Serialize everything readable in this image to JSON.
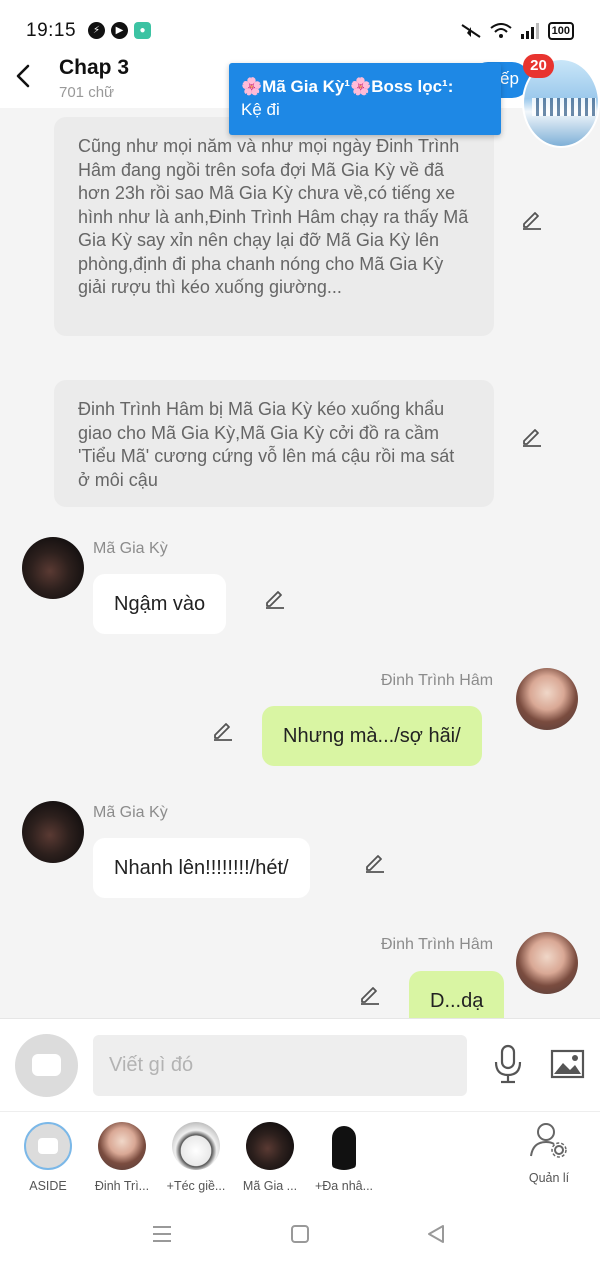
{
  "status_bar": {
    "time": "19:15",
    "battery": "100",
    "app_icons": [
      "messenger-icon",
      "media-icon",
      "chat-app-icon"
    ],
    "right_icons": [
      "mute-icon",
      "wifi-icon",
      "signal-icon"
    ]
  },
  "header": {
    "title": "Chap 3",
    "subtitle": "701 chữ"
  },
  "notification": {
    "sender": "🌸Mã Gia Kỳ¹🌸Boss lọc¹:",
    "message": "Kệ đi",
    "pill_text": "ếp",
    "badge_count": "20",
    "accent_color": "#1e88e5"
  },
  "messages": [
    {
      "type": "narration",
      "text": "Cũng như mọi năm và như mọi ngày Đinh Trình Hâm đang ngồi trên sofa đợi Mã Gia Kỳ về đã hơn 23h rồi sao Mã Gia Kỳ chưa về,có tiếng xe hình như là anh,Đinh Trình Hâm chạy ra thấy Mã Gia Kỳ say xỉn nên chạy lại đỡ Mã Gia Kỳ lên phòng,định đi pha chanh nóng cho Mã Gia Kỳ giải rượu thì kéo xuống giường..."
    },
    {
      "type": "narration",
      "text": "Đinh Trình Hâm bị Mã Gia Kỳ kéo xuống khẩu giao cho Mã Gia Kỳ,Mã Gia Kỳ cởi đồ ra cầm 'Tiểu Mã' cương cứng vỗ lên má cậu rồi ma sát ở môi cậu"
    },
    {
      "type": "left",
      "sender": "Mã Gia Kỳ",
      "text": "Ngậm vào"
    },
    {
      "type": "right",
      "sender": "Đinh Trình Hâm",
      "text": "Nhưng mà.../sợ hãi/"
    },
    {
      "type": "left",
      "sender": "Mã Gia Kỳ",
      "text": "Nhanh lên!!!!!!!!/hét/"
    },
    {
      "type": "right",
      "sender": "Đinh Trình Hâm",
      "text": "D...dạ"
    }
  ],
  "input": {
    "placeholder": "Viết gì đó"
  },
  "characters": [
    {
      "label": "ASIDE"
    },
    {
      "label": "Đinh Trì..."
    },
    {
      "label": "+Téc giề..."
    },
    {
      "label": "Mã Gia ..."
    },
    {
      "label": "+Đa nhâ..."
    }
  ],
  "manage_label": "Quản lí",
  "colors": {
    "right_bubble": "#d9f5a3",
    "left_bubble": "#ffffff",
    "narration_bg": "#ebebeb",
    "badge": "#e8342f"
  }
}
